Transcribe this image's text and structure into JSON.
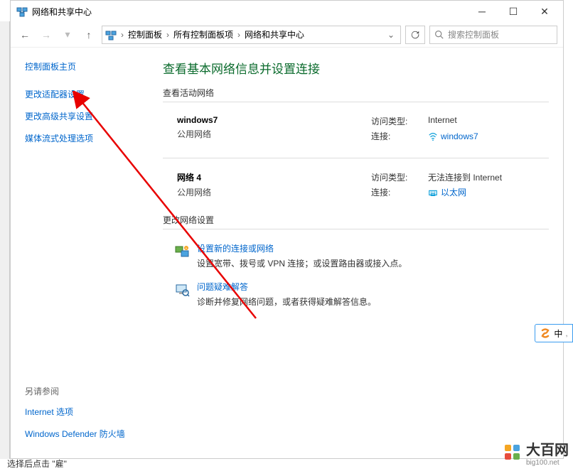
{
  "title": "网络和共享中心",
  "breadcrumbs": {
    "b0": "控制面板",
    "b1": "所有控制面板项",
    "b2": "网络和共享中心"
  },
  "search": {
    "placeholder": "搜索控制面板"
  },
  "sidebar": {
    "home": "控制面板主页",
    "link0": "更改适配器设置",
    "link1": "更改高级共享设置",
    "link2": "媒体流式处理选项",
    "footer_title": "另请参阅",
    "footer0": "Internet 选项",
    "footer1": "Windows Defender 防火墙"
  },
  "main": {
    "heading": "查看基本网络信息并设置连接",
    "sec_active": "查看活动网络",
    "sec_change": "更改网络设置",
    "net0": {
      "name": "windows7",
      "type": "公用网络",
      "access_label": "访问类型:",
      "access_value": "Internet",
      "conn_label": "连接:",
      "conn_link": "windows7"
    },
    "net1": {
      "name": "网络 4",
      "type": "公用网络",
      "access_label": "访问类型:",
      "access_value": "无法连接到 Internet",
      "conn_label": "连接:",
      "conn_link": "以太网"
    },
    "setting0": {
      "link": "设置新的连接或网络",
      "desc": "设置宽带、拨号或 VPN 连接；或设置路由器或接入点。"
    },
    "setting1": {
      "link": "问题疑难解答",
      "desc": "诊断并修复网络问题，或者获得疑难解答信息。"
    }
  },
  "ime": {
    "label": "中"
  },
  "watermark": {
    "text": "大百网",
    "sub": "big100.net"
  },
  "bottom": "选择后点击 \"雇\""
}
